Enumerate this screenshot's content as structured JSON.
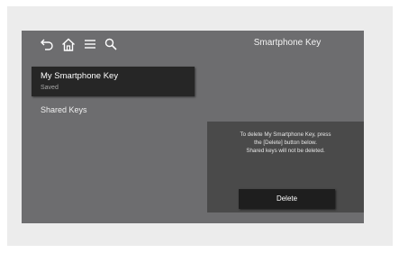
{
  "header": {
    "title": "Smartphone Key",
    "icons": [
      "back-icon",
      "home-icon",
      "menu-icon",
      "search-icon"
    ]
  },
  "list": {
    "selected": {
      "label": "My Smartphone Key",
      "status": "Saved"
    },
    "shared": {
      "label": "Shared Keys"
    }
  },
  "panel": {
    "message_lines": [
      "To delete My Smartphone Key, press",
      "the [Delete] button below.",
      "Shared keys will not be deleted."
    ],
    "delete_label": "Delete"
  },
  "colors": {
    "screen_bg": "#6d6d6f",
    "selected_bg": "#262626",
    "panel_bg": "#4a4a4a",
    "button_bg": "#1e1e1e"
  }
}
